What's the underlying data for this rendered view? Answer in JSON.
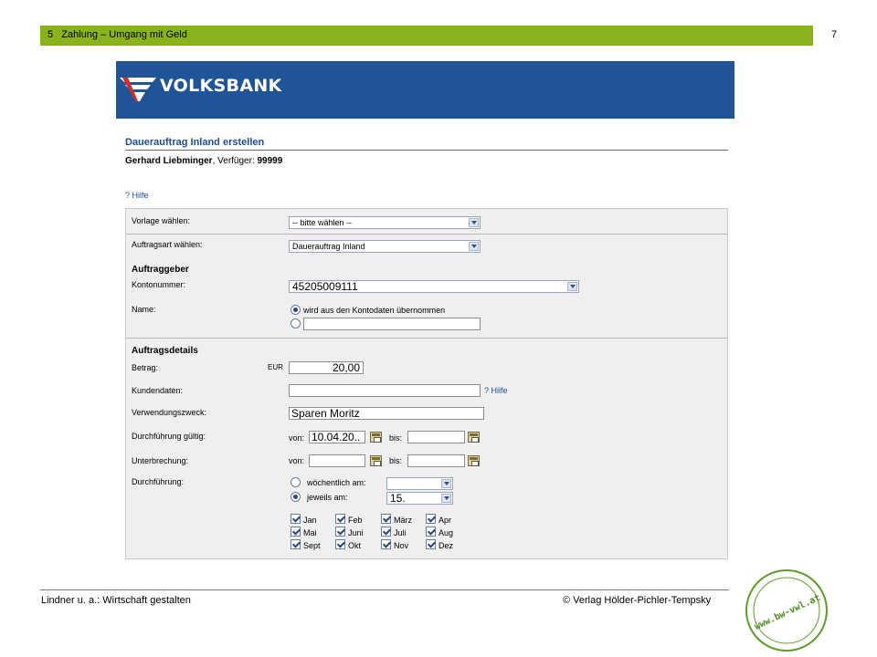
{
  "slide": {
    "header_text": "5   Zahlung – Umgang mit Geld",
    "page_number": "7",
    "header_color": "#8ab21a",
    "footer_left": "Lindner u. a.: Wirtschaft gestalten",
    "footer_right": "© Verlag Hölder-Pichler-Tempsky",
    "stamp_text": "www.bw-vwl.at"
  },
  "bank": {
    "name": "VOLKSBANK",
    "brand_color": "#1f5597"
  },
  "form": {
    "title": "Dauerauftrag Inland erstellen",
    "user_name": "Gerhard Liebminger",
    "user_suffix": ", Verfüger: ",
    "user_id": "99999",
    "help_top": "? Hilfe",
    "vorlage": {
      "label": "Vorlage wählen:",
      "value": "-- bitte wählen --"
    },
    "auftragsart": {
      "label": "Auftragsart wählen:",
      "value": "Dauerauftrag Inland"
    },
    "auftraggeber": {
      "heading": "Auftraggeber",
      "konto_label": "Kontonummer:",
      "konto_value": "45205009111",
      "name_label": "Name:",
      "name_option": "wird aus den Kontodaten übernommen",
      "name_value": ""
    },
    "details": {
      "heading": "Auftragsdetails",
      "betrag_label": "Betrag:",
      "currency": "EUR",
      "betrag_value": "20,00",
      "kunden_label": "Kundendaten:",
      "kunden_value": "",
      "kunden_help": "? Hilfe",
      "zweck_label": "Verwendungszweck:",
      "zweck_value": "Sparen Moritz",
      "gueltig_label": "Durchführung gültig:",
      "gueltig_von_label": "von:",
      "gueltig_von_value": "10.04.20..",
      "gueltig_bis_label": "bis:",
      "gueltig_bis_value": "",
      "unterbrechung_label": "Unterbrechung:",
      "unter_von_label": "von:",
      "unter_von_value": "",
      "unter_bis_label": "bis:",
      "unter_bis_value": "",
      "durchfuehrung_label": "Durchführung:",
      "weekly_label": "wöchentlich am:",
      "weekly_value": "",
      "monthly_label": "jeweils am:",
      "monthly_value": "15."
    },
    "months": [
      {
        "label": "Jan",
        "checked": true
      },
      {
        "label": "Feb",
        "checked": true
      },
      {
        "label": "März",
        "checked": true
      },
      {
        "label": "Apr",
        "checked": true
      },
      {
        "label": "Mai",
        "checked": true
      },
      {
        "label": "Juni",
        "checked": true
      },
      {
        "label": "Juli",
        "checked": true
      },
      {
        "label": "Aug",
        "checked": true
      },
      {
        "label": "Sept",
        "checked": true
      },
      {
        "label": "Okt",
        "checked": true
      },
      {
        "label": "Nov",
        "checked": true
      },
      {
        "label": "Dez",
        "checked": true
      }
    ]
  }
}
